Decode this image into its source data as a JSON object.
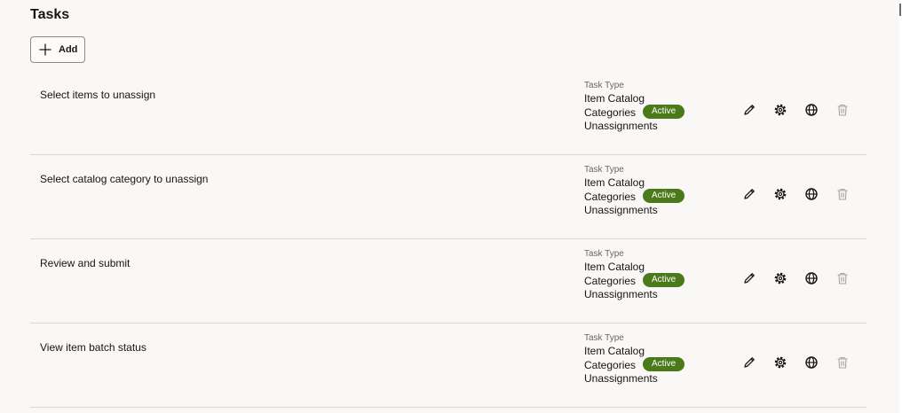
{
  "page": {
    "title": "Tasks"
  },
  "toolbar": {
    "add_label": "Add"
  },
  "task_type_label": "Task Type",
  "tasks": [
    {
      "name": "Select items to unassign",
      "task_type": "Item Catalog Categories Unassignments",
      "status": "Active"
    },
    {
      "name": "Select catalog category to unassign",
      "task_type": "Item Catalog Categories Unassignments",
      "status": "Active"
    },
    {
      "name": "Review and submit",
      "task_type": "Item Catalog Categories Unassignments",
      "status": "Active"
    },
    {
      "name": "View item batch status",
      "task_type": "Item Catalog Categories Unassignments",
      "status": "Active"
    }
  ],
  "actions": {
    "edit": "pencil-icon",
    "settings": "gear-icon",
    "translate": "globe-icon",
    "delete": "trash-icon"
  },
  "colors": {
    "status_active": "#4b7a1b",
    "background": "#f9f8f6",
    "divider": "#dcd9d4"
  }
}
